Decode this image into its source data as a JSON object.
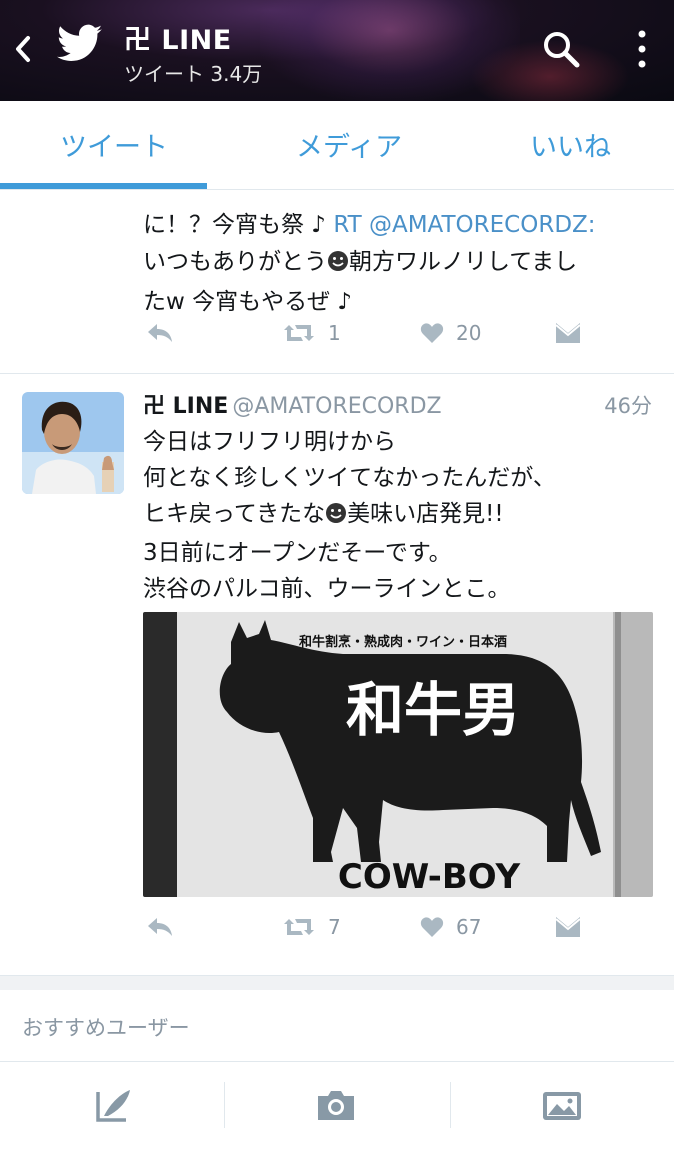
{
  "header": {
    "account_name": "卍 LINE",
    "tweet_count": "ツイート 3.4万",
    "icons": [
      "back-icon",
      "twitter-bird-icon",
      "search-icon",
      "more-options-icon"
    ]
  },
  "tabs": [
    {
      "label": "ツイート",
      "active": true
    },
    {
      "label": "メディア",
      "active": false
    },
    {
      "label": "いいね",
      "active": false
    }
  ],
  "accent_color": "#3f9bd9",
  "tweets": [
    {
      "lines": [
        "に！？今宵も祭 ♪ ",
        "いつもありがとう",
        "朝方ワルノリしてまし",
        "たw  今宵もやるぜ ♪"
      ],
      "mention": "RT @AMATORECORDZ:",
      "retweets": "1",
      "likes": "20"
    },
    {
      "name": "卍 LINE",
      "handle": "@AMATORECORDZ",
      "time": "46分",
      "lines": [
        "今日はフリフリ明けから",
        "何となく珍しくツイてなかったんだが、",
        "ヒキ戻ってきたな",
        "美味い店発見!!",
        "3日前にオープンだそーです。",
        "渋谷のパルコ前、ウーラインとこ。"
      ],
      "image": {
        "top_text": "和牛割烹・熟成肉・ワイン・日本酒",
        "main_text": "和牛男",
        "sub_text": "COW-BOY"
      },
      "retweets": "7",
      "likes": "67"
    }
  ],
  "suggested_users_label": "おすすめユーザー",
  "bottom_bar": {
    "icons": [
      "compose-tweet-icon",
      "camera-icon",
      "gallery-icon"
    ]
  }
}
